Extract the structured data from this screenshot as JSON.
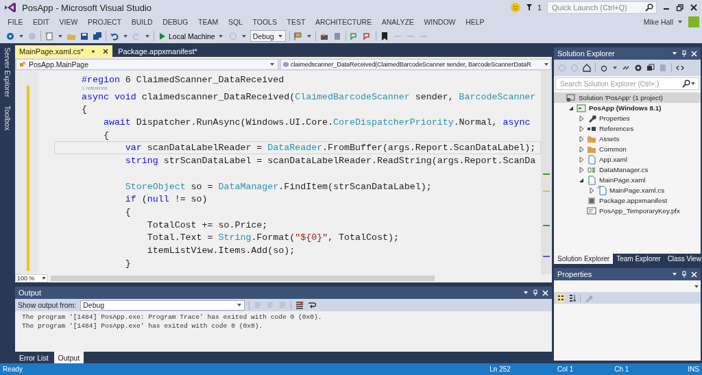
{
  "window": {
    "title": "PosApp - Microsoft Visual Studio",
    "notification_count": "1",
    "quick_launch": {
      "placeholder": "Quick Launch (Ctrl+Q)"
    },
    "user": "Mike Hall"
  },
  "menu": [
    "FILE",
    "EDIT",
    "VIEW",
    "PROJECT",
    "BUILD",
    "DEBUG",
    "TEAM",
    "SQL",
    "TOOLS",
    "TEST",
    "ARCHITECTURE",
    "ANALYZE",
    "WINDOW",
    "HELP"
  ],
  "toolbar": {
    "target": "Local Machine",
    "configuration": "Debug"
  },
  "side_strip": [
    "Server Explorer",
    "Toolbox"
  ],
  "editor": {
    "tabs": [
      {
        "label": "MainPage.xaml.cs*",
        "selected": true
      },
      {
        "label": "Package.appxmanifest*",
        "selected": false
      }
    ],
    "type_nav": "PosApp.MainPage",
    "member_nav": "claimedscanner_DataReceived(ClaimedBarcodeScanner sender, BarcodeScannerDataR",
    "lines": [
      {
        "kind": "code",
        "current": false,
        "tokens": [
          {
            "kind": "keyword",
            "text": "#region"
          },
          {
            "kind": "plain",
            "text": " 6 ClaimedScanner_DataReceived"
          }
        ]
      },
      {
        "kind": "codelens",
        "current": false,
        "text": "1 reference"
      },
      {
        "kind": "code",
        "current": false,
        "tokens": [
          {
            "kind": "keyword",
            "text": "async void"
          },
          {
            "kind": "plain",
            "text": " claimedscanner_DataReceived("
          },
          {
            "kind": "type",
            "text": "ClaimedBarcodeScanner"
          },
          {
            "kind": "plain",
            "text": " sender, "
          },
          {
            "kind": "type",
            "text": "BarcodeScanner"
          }
        ]
      },
      {
        "kind": "code",
        "current": false,
        "tokens": [
          {
            "kind": "plain",
            "text": "{"
          }
        ]
      },
      {
        "kind": "code",
        "current": false,
        "tokens": [
          {
            "kind": "keyword",
            "text": "    await"
          },
          {
            "kind": "plain",
            "text": " Dispatcher.RunAsync(Windows.UI.Core."
          },
          {
            "kind": "type",
            "text": "CoreDispatcherPriority"
          },
          {
            "kind": "plain",
            "text": ".Normal, "
          },
          {
            "kind": "keyword",
            "text": "async"
          }
        ]
      },
      {
        "kind": "code",
        "current": false,
        "tokens": [
          {
            "kind": "plain",
            "text": "    {"
          }
        ]
      },
      {
        "kind": "code",
        "current": true,
        "tokens": [
          {
            "kind": "keyword",
            "text": "        var"
          },
          {
            "kind": "plain",
            "text": " scanDataLabelReader = "
          },
          {
            "kind": "type",
            "text": "DataReader"
          },
          {
            "kind": "plain",
            "text": ".FromBuffer(args.Report.ScanDataLabel);"
          }
        ]
      },
      {
        "kind": "code",
        "current": false,
        "tokens": [
          {
            "kind": "keyword",
            "text": "        string"
          },
          {
            "kind": "plain",
            "text": " strScanDataLabel = scanDataLabelReader.ReadString(args.Report.ScanDa"
          }
        ]
      },
      {
        "kind": "blank",
        "current": false
      },
      {
        "kind": "code",
        "current": false,
        "tokens": [
          {
            "kind": "type",
            "text": "        StoreObject"
          },
          {
            "kind": "plain",
            "text": " so = "
          },
          {
            "kind": "type",
            "text": "DataManager"
          },
          {
            "kind": "plain",
            "text": ".FindItem(strScanDataLabel);"
          }
        ]
      },
      {
        "kind": "code",
        "current": false,
        "tokens": [
          {
            "kind": "keyword",
            "text": "        if"
          },
          {
            "kind": "plain",
            "text": " ("
          },
          {
            "kind": "keyword",
            "text": "null"
          },
          {
            "kind": "plain",
            "text": " != so)"
          }
        ]
      },
      {
        "kind": "code",
        "current": false,
        "tokens": [
          {
            "kind": "plain",
            "text": "        {"
          }
        ]
      },
      {
        "kind": "code",
        "current": false,
        "tokens": [
          {
            "kind": "plain",
            "text": "            TotalCost += so.Price;"
          }
        ]
      },
      {
        "kind": "code",
        "current": false,
        "tokens": [
          {
            "kind": "plain",
            "text": "            Total.Text = "
          },
          {
            "kind": "type",
            "text": "String"
          },
          {
            "kind": "plain",
            "text": ".Format("
          },
          {
            "kind": "string",
            "text": "\"${0}\""
          },
          {
            "kind": "plain",
            "text": ", TotalCost);"
          }
        ]
      },
      {
        "kind": "code",
        "current": false,
        "tokens": [
          {
            "kind": "plain",
            "text": "            itemListView.Items.Add(so);"
          }
        ]
      },
      {
        "kind": "code",
        "current": false,
        "tokens": [
          {
            "kind": "plain",
            "text": "        }"
          }
        ]
      }
    ],
    "zoom": "100 %"
  },
  "output": {
    "title": "Output",
    "source_label": "Show output from:",
    "source": "Debug",
    "lines": [
      "The program '[1484] PosApp.exe: Program Trace' has exited with code 0 (0x0).",
      "The program '[1484] PosApp.exe' has exited with code 0 (0x0)."
    ],
    "tabs": [
      {
        "label": "Error List",
        "selected": false
      },
      {
        "label": "Output",
        "selected": true
      }
    ]
  },
  "solution_explorer": {
    "title": "Solution Explorer",
    "search": {
      "placeholder": "Search Solution Explorer (Ctrl+;)"
    },
    "tree": [
      {
        "label": "Solution 'PosApp' (1 project)",
        "kind": "solution",
        "selected": true,
        "children": [
          {
            "label": "PosApp (Windows 8.1)",
            "kind": "project",
            "selected": false,
            "expanded": true,
            "children": [
              {
                "label": "Properties",
                "kind": "properties",
                "selected": false,
                "expanded": false
              },
              {
                "label": "References",
                "kind": "references",
                "selected": false,
                "expanded": false
              },
              {
                "label": "Assets",
                "kind": "folder",
                "selected": false,
                "expanded": false
              },
              {
                "label": "Common",
                "kind": "folder",
                "selected": false,
                "expanded": false
              },
              {
                "label": "App.xaml",
                "kind": "page",
                "selected": false,
                "expanded": false
              },
              {
                "label": "DataManager.cs",
                "kind": "csharp",
                "selected": false,
                "expanded": false
              },
              {
                "label": "MainPage.xaml",
                "kind": "page",
                "selected": false,
                "expanded": true,
                "children": [
                  {
                    "label": "MainPage.xaml.cs",
                    "kind": "codepage",
                    "selected": false,
                    "expanded": false
                  }
                ]
              },
              {
                "label": "Package.appxmanifest",
                "kind": "manifest",
                "selected": false
              },
              {
                "label": "PosApp_TemporaryKey.pfx",
                "kind": "certificate",
                "selected": false
              }
            ]
          }
        ]
      }
    ],
    "tabs": [
      {
        "label": "Solution Explorer",
        "selected": true
      },
      {
        "label": "Team Explorer",
        "selected": false
      },
      {
        "label": "Class View",
        "selected": false
      }
    ]
  },
  "properties": {
    "title": "Properties"
  },
  "status_bar": {
    "message": "Ready",
    "line": "Ln 252",
    "column": "Col 1",
    "char": "Ch 1",
    "mode": "INS"
  }
}
